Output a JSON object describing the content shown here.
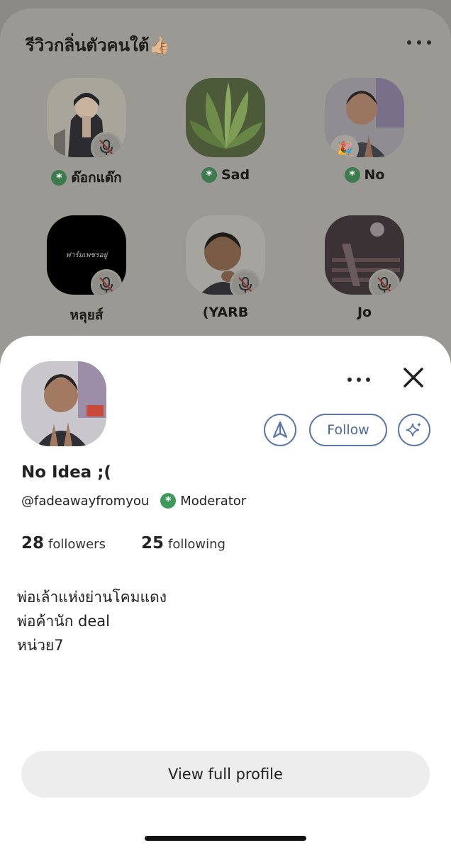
{
  "room": {
    "title": "รีวิวกลิ่นตัวคนใต้👍🏼",
    "speakers": [
      {
        "name": "ด๊อกแด๊ก",
        "moderator": true,
        "muted": true
      },
      {
        "name": "Sad",
        "moderator": true,
        "muted": false
      },
      {
        "name": "No",
        "moderator": true,
        "muted": false,
        "badge": "🎉"
      },
      {
        "name": "หลุยส์",
        "moderator": false,
        "muted": true,
        "avatar_text": "ฟาร์มเพชรอยู่"
      },
      {
        "name": "(YARB",
        "moderator": false,
        "muted": true
      },
      {
        "name": "Jo",
        "moderator": false,
        "muted": true
      }
    ]
  },
  "profile": {
    "name": "No Idea ;(",
    "handle": "@fadeawayfromyou",
    "role": "Moderator",
    "followers_count": "28",
    "followers_label": "followers",
    "following_count": "25",
    "following_label": "following",
    "bio": [
      "พ่อเล้าแห่งย่านโคมแดง",
      "พ่อค้านัก deal",
      "หน่วย7"
    ],
    "follow_label": "Follow",
    "view_full_label": "View full profile"
  },
  "icons": {
    "more": "more-horizontal-icon",
    "close": "close-icon",
    "mod": "moderator-asterisk-icon",
    "mic_off": "mic-off-icon",
    "wave": "wave-icon",
    "sparkle": "sparkle-icon"
  },
  "colors": {
    "accent": "#5b76a8",
    "moderator": "#3f9a5a",
    "sheet": "#ffffff",
    "overlay": "#8b8a84"
  }
}
